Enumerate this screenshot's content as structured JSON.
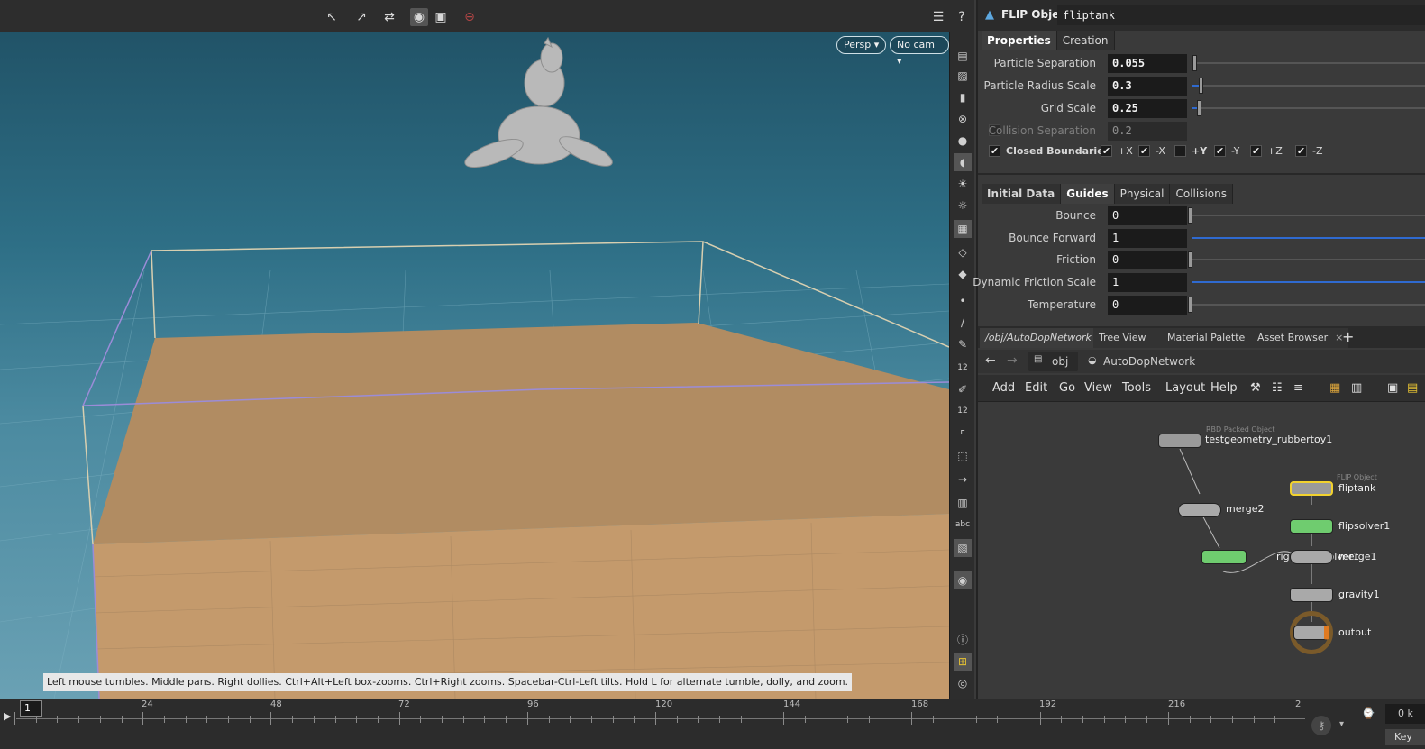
{
  "viewport": {
    "toolbar_icons": [
      "select-icon",
      "move-icon",
      "transform-icon",
      "display-options-icon",
      "camera-icon",
      "stop-icon"
    ],
    "camera_menu": "Persp ▾",
    "cam_menu": "No cam ▾",
    "help_icon": "?",
    "hint": "Left mouse tumbles. Middle pans. Right dollies. Ctrl+Alt+Left box-zooms. Ctrl+Right zooms. Spacebar-Ctrl-Left tilts. Hold L for alternate tumble, dolly, and zoom.",
    "side_labels": [
      "abc"
    ]
  },
  "params": {
    "node_type": "FLIP Object",
    "node_name": "fliptank",
    "tabs": [
      "Properties",
      "Creation"
    ],
    "rows": [
      {
        "label": "Particle Separation",
        "value": "0.055",
        "slider": 0.0
      },
      {
        "label": "Particle Radius Scale",
        "value": "0.3",
        "slider": 0.04
      },
      {
        "label": "Grid Scale",
        "value": "0.25",
        "slider": 0.03
      },
      {
        "label": "Collision Separation",
        "value": "0.2",
        "slider": 0.0
      }
    ],
    "closed_boundaries_label": "Closed Boundaries",
    "axes": [
      "+X",
      "-X",
      "+Y",
      "-Y",
      "+Z",
      "-Z"
    ],
    "sub_tabs": [
      "Initial Data",
      "Guides",
      "Physical",
      "Collisions"
    ],
    "sub_rows": [
      {
        "label": "Bounce",
        "value": "0"
      },
      {
        "label": "Bounce Forward",
        "value": "1"
      },
      {
        "label": "Friction",
        "value": "0"
      },
      {
        "label": "Dynamic Friction Scale",
        "value": "1"
      },
      {
        "label": "Temperature",
        "value": "0"
      }
    ]
  },
  "network": {
    "tabs": [
      "/obj/AutoDopNetwork",
      "Tree View",
      "Material Palette",
      "Asset Browser"
    ],
    "close_glyph": "×",
    "add_glyph": "+",
    "path": [
      "obj",
      "AutoDopNetwork"
    ],
    "menu": [
      "Add",
      "Edit",
      "Go",
      "View",
      "Tools",
      "Layout",
      "Help"
    ],
    "nodes": {
      "rbd_type": "RBD Packed Object",
      "rbd_name": "testgeometry_rubbertoy1",
      "flip_type": "FLIP Object",
      "flip_name": "fliptank",
      "merge2": "merge2",
      "flipsolver": "flipsolver1",
      "rigidbody": "rigidbodysolver1",
      "merge1": "merge1",
      "gravity": "gravity1",
      "output": "output"
    }
  },
  "timeline": {
    "current_frame": "1",
    "ticks": [
      "24",
      "48",
      "72",
      "96",
      "120",
      "144",
      "168",
      "192",
      "216",
      "2"
    ],
    "right_label": "0 k",
    "key_label": "Key"
  }
}
